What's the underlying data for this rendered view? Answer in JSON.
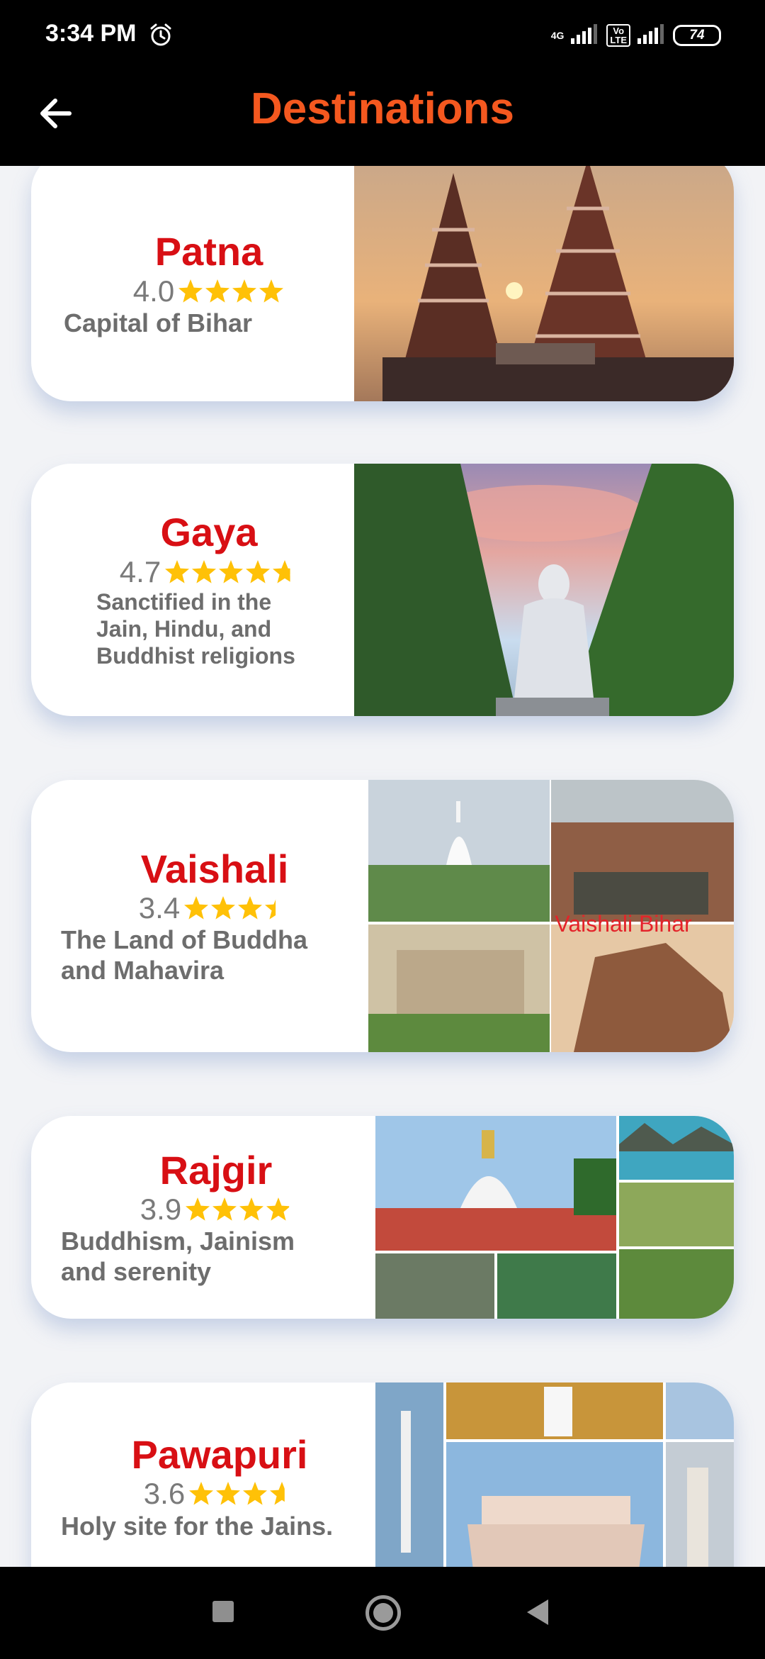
{
  "status_bar": {
    "time": "3:34 PM",
    "network_label": "4G",
    "volte_label": "Vo\nLTE",
    "battery": "74"
  },
  "header": {
    "title": "Destinations",
    "back_icon": "arrow-left-icon"
  },
  "destinations": [
    {
      "name": "Patna",
      "rating": "4.0",
      "rating_value": 4.0,
      "description": "Capital of Bihar",
      "image_icon": "temple-photo"
    },
    {
      "name": "Gaya",
      "rating": "4.7",
      "rating_value": 4.7,
      "description": "Sanctified in the\nJain, Hindu, and\nBuddhist religions",
      "image_icon": "buddha-statue-photo"
    },
    {
      "name": "Vaishali",
      "rating": "3.4",
      "rating_value": 3.4,
      "description": "The Land of Buddha\nand Mahavira",
      "image_icon": "vaishali-collage-photo",
      "image_caption": "Vaishali Bihar"
    },
    {
      "name": "Rajgir",
      "rating": "3.9",
      "rating_value": 3.9,
      "description": "Buddhism, Jainism\n and serenity",
      "image_icon": "rajgir-collage-photo"
    },
    {
      "name": "Pawapuri",
      "rating": "3.6",
      "rating_value": 3.6,
      "description": "Holy site for the Jains.",
      "image_icon": "pawapuri-collage-photo"
    }
  ],
  "colors": {
    "title": "#f4581f",
    "destination_name": "#d80f14",
    "star": "#ffc107",
    "background": "#f2f3f6"
  },
  "nav_bar": {
    "recent_icon": "square-icon",
    "home_icon": "circle-home-icon",
    "back_icon": "triangle-back-icon"
  }
}
